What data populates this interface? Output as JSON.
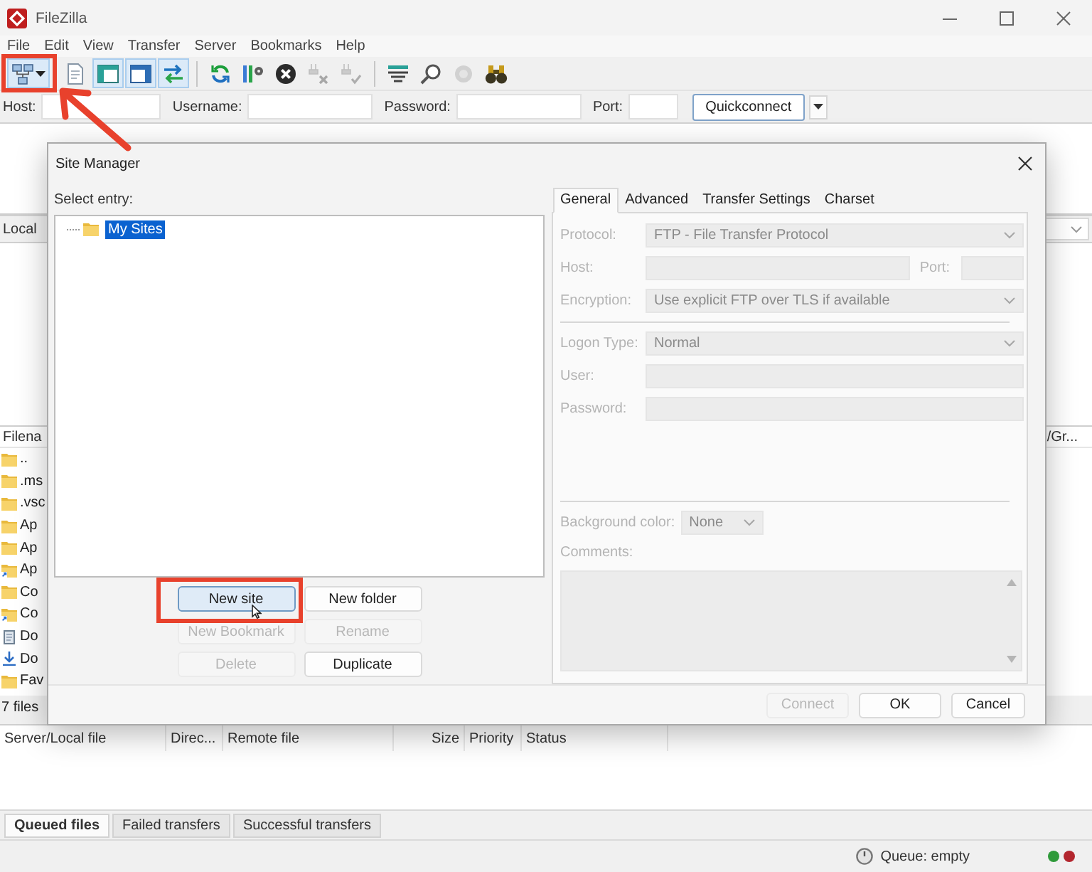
{
  "window": {
    "title": "FileZilla"
  },
  "menu": [
    "File",
    "Edit",
    "View",
    "Transfer",
    "Server",
    "Bookmarks",
    "Help"
  ],
  "toolbar": {
    "pointer_arrow": true,
    "items": [
      {
        "kind": "site-manager",
        "pressed": true,
        "disabled": false,
        "highlighted": true
      },
      {
        "kind": "message-log",
        "pressed": false,
        "disabled": false,
        "highlighted": false
      },
      {
        "kind": "local-tree",
        "pressed": true,
        "disabled": false,
        "highlighted": false
      },
      {
        "kind": "remote-tree",
        "pressed": true,
        "disabled": false,
        "highlighted": false
      },
      {
        "kind": "transfer-queue",
        "pressed": true,
        "disabled": false,
        "highlighted": false
      },
      {
        "kind": "separator"
      },
      {
        "kind": "refresh",
        "pressed": false,
        "disabled": false,
        "highlighted": false
      },
      {
        "kind": "process-queue",
        "pressed": false,
        "disabled": false,
        "highlighted": false
      },
      {
        "kind": "cancel",
        "pressed": false,
        "disabled": false,
        "highlighted": false
      },
      {
        "kind": "disconnect",
        "pressed": false,
        "disabled": true,
        "highlighted": false
      },
      {
        "kind": "reconnect",
        "pressed": false,
        "disabled": true,
        "highlighted": false
      },
      {
        "kind": "separator"
      },
      {
        "kind": "filter",
        "pressed": false,
        "disabled": false,
        "highlighted": false
      },
      {
        "kind": "compare",
        "pressed": false,
        "disabled": false,
        "highlighted": false
      },
      {
        "kind": "sync-browsing",
        "pressed": false,
        "disabled": true,
        "highlighted": false
      },
      {
        "kind": "search",
        "pressed": false,
        "disabled": false,
        "highlighted": false
      }
    ]
  },
  "quickconnect": {
    "fields": [
      {
        "label": "Host:",
        "kind": "text"
      },
      {
        "label": "Username:",
        "kind": "text"
      },
      {
        "label": "Password:",
        "kind": "text"
      },
      {
        "label": "Port:",
        "kind": "port"
      }
    ],
    "button": "Quickconnect"
  },
  "local_pane": {
    "path_label": "Local",
    "file_column": "Filena",
    "files": [
      {
        "name": "..",
        "kind": "folder"
      },
      {
        "name": ".ms",
        "kind": "folder"
      },
      {
        "name": ".vsc",
        "kind": "folder"
      },
      {
        "name": "Ap",
        "kind": "folder"
      },
      {
        "name": "Ap",
        "kind": "folder"
      },
      {
        "name": "Ap",
        "kind": "shortcut"
      },
      {
        "name": "Co",
        "kind": "folder"
      },
      {
        "name": "Co",
        "kind": "shortcut"
      },
      {
        "name": "Do",
        "kind": "document"
      },
      {
        "name": "Do",
        "kind": "download"
      },
      {
        "name": "Fav",
        "kind": "folder"
      }
    ],
    "status": "7 files"
  },
  "remote_pane": {
    "file_column": "/Gr..."
  },
  "queue": {
    "columns": [
      "Server/Local file",
      "Direc...",
      "Remote file",
      "Size",
      "Priority",
      "Status"
    ]
  },
  "queue_tabs": [
    {
      "label": "Queued files",
      "selected": true
    },
    {
      "label": "Failed transfers",
      "selected": false
    },
    {
      "label": "Successful transfers",
      "selected": false
    }
  ],
  "status_bar": {
    "queue": "Queue: empty",
    "indicators": [
      {
        "color": "#2f9a3a"
      },
      {
        "color": "#b3262e"
      }
    ]
  },
  "site_manager": {
    "title": "Site Manager",
    "select_label": "Select entry:",
    "tree": [
      {
        "label": "My Sites",
        "selected": true
      }
    ],
    "buttons": [
      {
        "label": "New site",
        "disabled": false,
        "hovered": true,
        "highlighted": true
      },
      {
        "label": "New folder",
        "disabled": false,
        "hovered": false,
        "highlighted": false
      },
      {
        "label": "New Bookmark",
        "disabled": true,
        "hovered": false,
        "highlighted": false
      },
      {
        "label": "Rename",
        "disabled": true,
        "hovered": false,
        "highlighted": false
      },
      {
        "label": "Delete",
        "disabled": true,
        "hovered": false,
        "highlighted": false
      },
      {
        "label": "Duplicate",
        "disabled": false,
        "hovered": false,
        "highlighted": false
      }
    ],
    "tabs": [
      {
        "label": "General",
        "selected": true
      },
      {
        "label": "Advanced",
        "selected": false
      },
      {
        "label": "Transfer Settings",
        "selected": false
      },
      {
        "label": "Charset",
        "selected": false
      }
    ],
    "general": {
      "connection": [
        {
          "kind": "select",
          "label": "Protocol:",
          "value": "FTP - File Transfer Protocol",
          "disabled": true
        },
        {
          "kind": "host",
          "label": "Host:",
          "port_label": "Port:",
          "disabled": true
        },
        {
          "kind": "select",
          "label": "Encryption:",
          "value": "Use explicit FTP over TLS if available",
          "disabled": true
        }
      ],
      "logon": [
        {
          "kind": "select",
          "label": "Logon Type:",
          "value": "Normal",
          "disabled": true
        },
        {
          "kind": "input",
          "label": "User:",
          "disabled": true
        },
        {
          "kind": "input",
          "label": "Password:",
          "disabled": true
        }
      ],
      "background_color": {
        "label": "Background color:",
        "value": "None",
        "disabled": true
      },
      "comments": {
        "label": "Comments:",
        "disabled": true
      }
    },
    "footer_buttons": [
      {
        "label": "Connect",
        "disabled": true
      },
      {
        "label": "OK",
        "disabled": false
      },
      {
        "label": "Cancel",
        "disabled": false
      }
    ]
  }
}
